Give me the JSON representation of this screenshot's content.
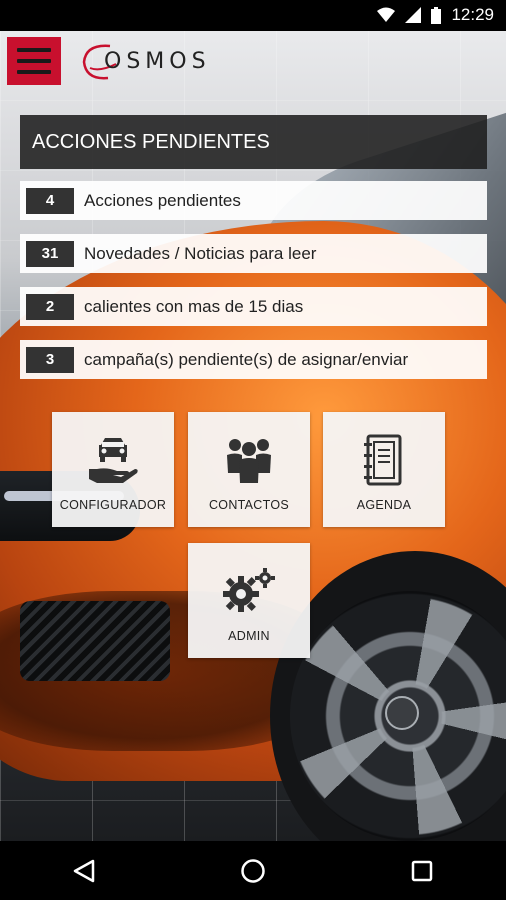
{
  "status_bar": {
    "time": "12:29"
  },
  "app": {
    "logo_text": "OSMOS",
    "accent_color": "#c8102e"
  },
  "panel": {
    "title": "ACCIONES PENDIENTES"
  },
  "actions": [
    {
      "count": "4",
      "label": "Acciones pendientes"
    },
    {
      "count": "31",
      "label": "Novedades / Noticias para leer"
    },
    {
      "count": "2",
      "label": "calientes con mas de 15 dias"
    },
    {
      "count": "3",
      "label": "campaña(s) pendiente(s) de asignar/enviar"
    }
  ],
  "tiles": [
    {
      "label": "CONFIGURADOR",
      "icon": "car-hand-icon"
    },
    {
      "label": "CONTACTOS",
      "icon": "people-icon"
    },
    {
      "label": "AGENDA",
      "icon": "notebook-icon"
    },
    {
      "label": "ADMIN",
      "icon": "gears-icon"
    }
  ],
  "nav": {
    "back": "back-icon",
    "home": "home-icon",
    "recents": "recents-icon"
  }
}
